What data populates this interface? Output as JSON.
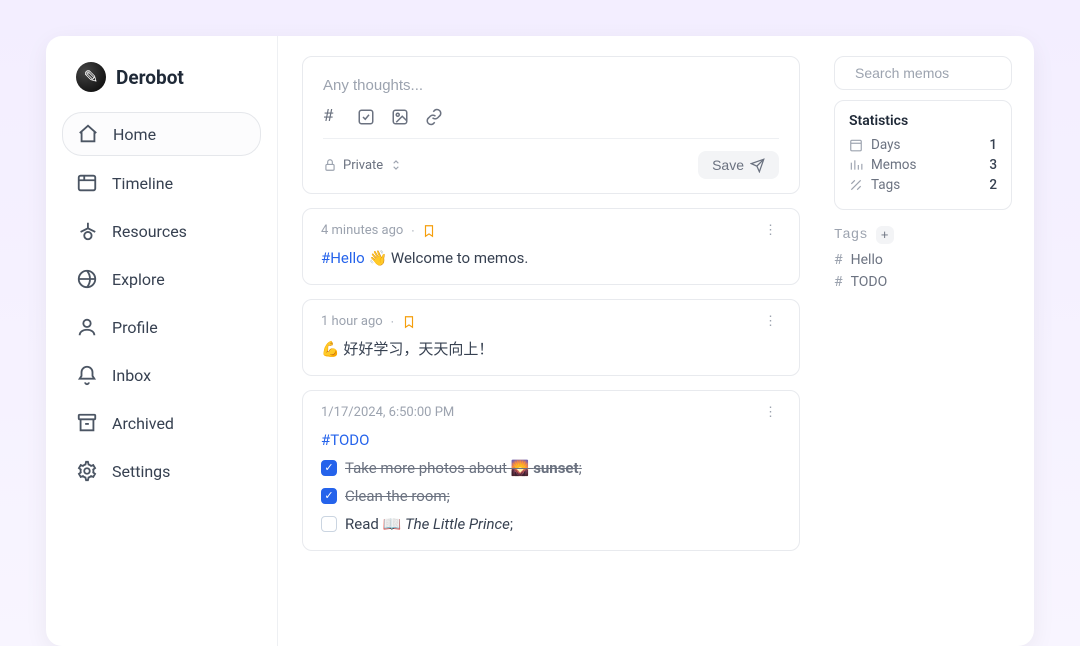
{
  "brand": {
    "name": "Derobot"
  },
  "nav": [
    {
      "id": "home",
      "label": "Home",
      "active": true
    },
    {
      "id": "timeline",
      "label": "Timeline",
      "active": false
    },
    {
      "id": "resources",
      "label": "Resources",
      "active": false
    },
    {
      "id": "explore",
      "label": "Explore",
      "active": false
    },
    {
      "id": "profile",
      "label": "Profile",
      "active": false
    },
    {
      "id": "inbox",
      "label": "Inbox",
      "active": false
    },
    {
      "id": "archived",
      "label": "Archived",
      "active": false
    },
    {
      "id": "settings",
      "label": "Settings",
      "active": false
    }
  ],
  "composer": {
    "placeholder": "Any thoughts...",
    "visibility_label": "Private",
    "save_label": "Save"
  },
  "memos": [
    {
      "time": "4 minutes ago",
      "pinned": true,
      "content_html": "<span class='hl'>#Hello</span> 👋 Welcome to memos."
    },
    {
      "time": "1 hour ago",
      "pinned": true,
      "content_html": "💪 好好学习，天天向上！"
    },
    {
      "time": "1/17/2024, 6:50:00 PM",
      "pinned": false,
      "content_html": "<span class='hl'>#TODO</span>",
      "todos": [
        {
          "done": true,
          "html": "Take more photos about 🌄 <strong>sunset</strong>;"
        },
        {
          "done": true,
          "html": "Clean the room;"
        },
        {
          "done": false,
          "html": "Read 📖 <em>The Little Prince</em>;"
        }
      ]
    }
  ],
  "search": {
    "placeholder": "Search memos"
  },
  "stats": {
    "title": "Statistics",
    "rows": [
      {
        "label": "Days",
        "value": "1"
      },
      {
        "label": "Memos",
        "value": "3"
      },
      {
        "label": "Tags",
        "value": "2"
      }
    ]
  },
  "tags": {
    "title": "Tags",
    "items": [
      {
        "name": "Hello"
      },
      {
        "name": "TODO"
      }
    ]
  }
}
